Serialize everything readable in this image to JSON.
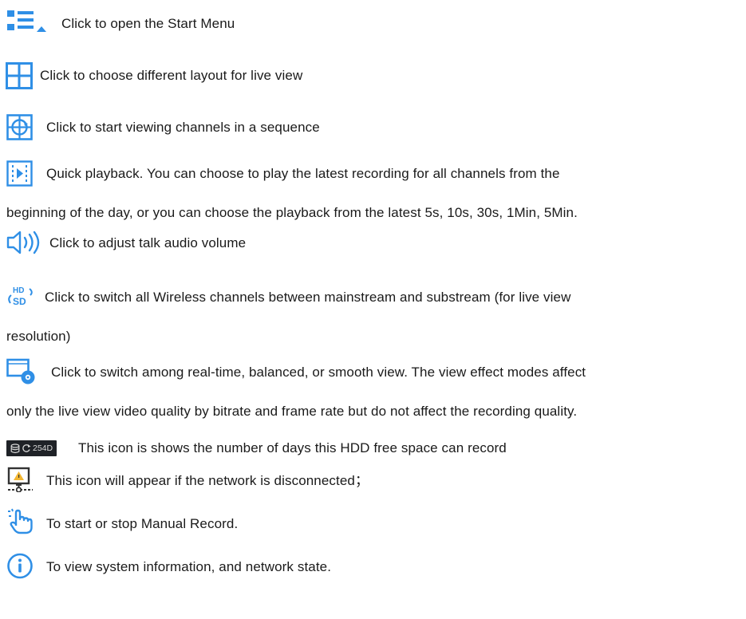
{
  "items": [
    {
      "icon": "start-menu-icon",
      "text": "Click to open the Start Menu"
    },
    {
      "icon": "layout-grid-icon",
      "text": "Click to choose different layout for live view"
    },
    {
      "icon": "sequence-view-icon",
      "text": "Click to start viewing channels in a sequence"
    },
    {
      "icon": "quick-playback-icon",
      "line1": "Quick playback. You can choose to play the latest recording for all channels from the",
      "line2": "beginning of the day, or you can choose the playback from the latest 5s, 10s, 30s, 1Min, 5Min."
    },
    {
      "icon": "talk-volume-icon",
      "text": "Click to adjust talk audio volume"
    },
    {
      "icon": "hd-sd-icon",
      "icon_text_top": "HD",
      "icon_text_bottom": "SD",
      "line1": "Click to switch all Wireless channels between mainstream and substream (for live view",
      "line2": "resolution)"
    },
    {
      "icon": "view-effect-icon",
      "line1": "Click to switch among real-time, balanced, or smooth view. The view effect modes affect",
      "line2": "only the live view video quality by bitrate and frame rate but do not affect the recording quality."
    },
    {
      "icon": "hdd-days-icon",
      "badge": "254D",
      "text": "This icon is shows the number of days this HDD free space can record"
    },
    {
      "icon": "network-disconnected-icon",
      "text": "This icon will appear if the network is disconnected；"
    },
    {
      "icon": "manual-record-icon",
      "text": "To start or stop Manual Record."
    },
    {
      "icon": "info-icon",
      "text": "To view system information, and network state."
    }
  ],
  "colors": {
    "icon_blue": "#2f8fe6",
    "text": "#1a1a1a",
    "badge_bg": "#1f2227"
  }
}
